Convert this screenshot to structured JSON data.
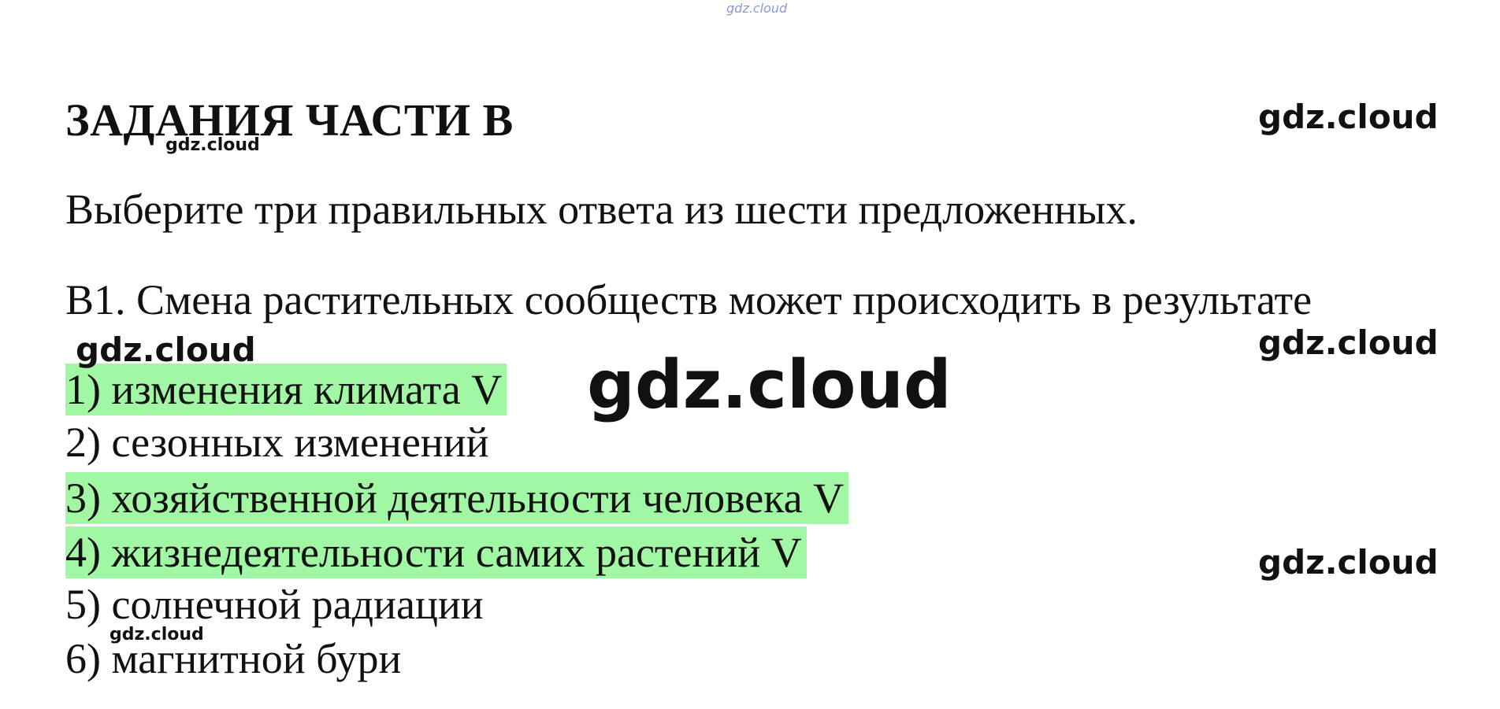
{
  "watermarks": {
    "text": "gdz.cloud"
  },
  "part": {
    "title": "ЗАДАНИЯ ЧАСТИ В",
    "instruction": "Выберите три правильных ответа из шести предложенных."
  },
  "question": {
    "text": "В1. Смена растительных сообществ может происходить в результате",
    "highlight_color": "#a1f7a3",
    "options": [
      {
        "text": "1) изменения климата V",
        "correct": true
      },
      {
        "text": "2) сезонных изменений",
        "correct": false
      },
      {
        "text": "3) хозяйственной деятельности человека V",
        "correct": true
      },
      {
        "text": "4) жизнедеятельности самих растений V",
        "correct": true
      },
      {
        "text": "5) солнечной радиации",
        "correct": false
      },
      {
        "text": "6) магнитной бури",
        "correct": false
      }
    ]
  }
}
